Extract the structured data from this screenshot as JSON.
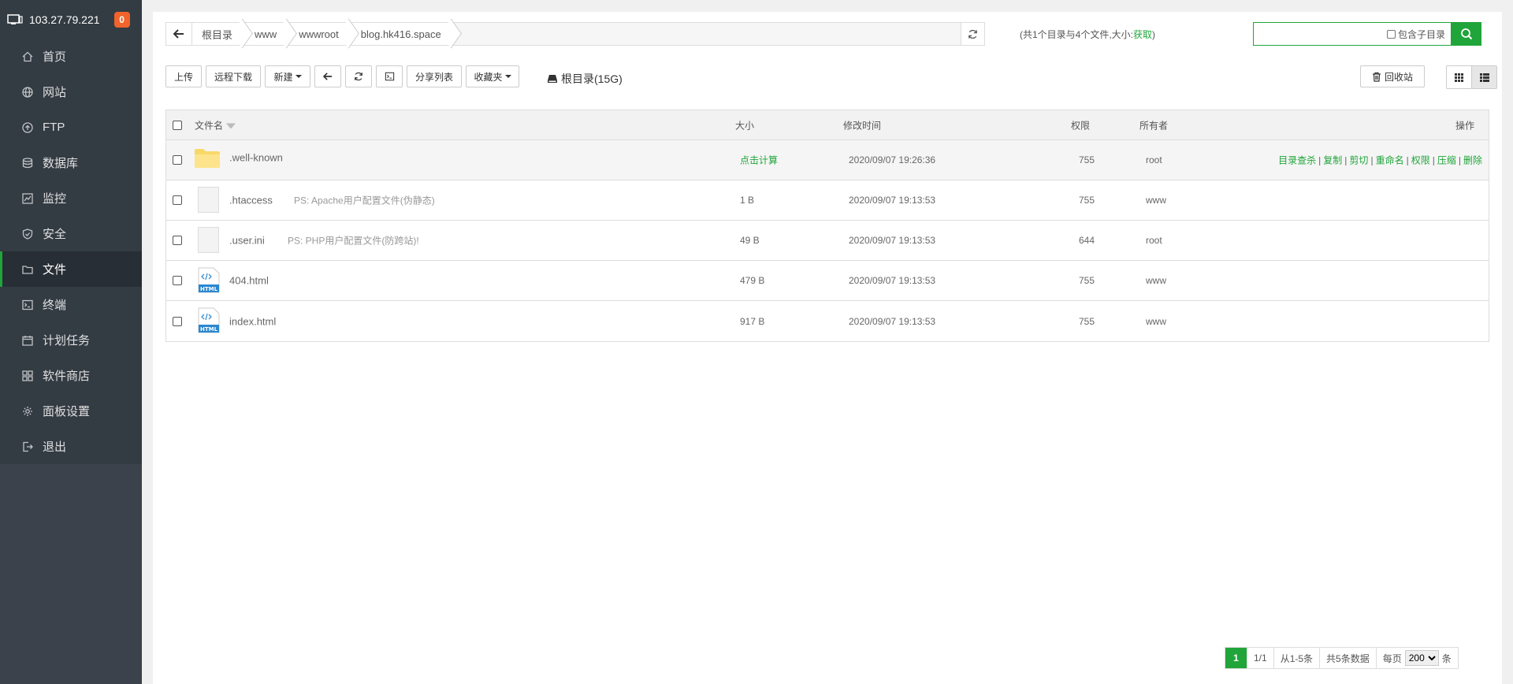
{
  "sidebar": {
    "host": "103.27.79.221",
    "badge": "0",
    "items": [
      {
        "label": "首页",
        "icon": "home-icon"
      },
      {
        "label": "网站",
        "icon": "globe-icon"
      },
      {
        "label": "FTP",
        "icon": "ftp-icon"
      },
      {
        "label": "数据库",
        "icon": "database-icon"
      },
      {
        "label": "监控",
        "icon": "monitor-icon"
      },
      {
        "label": "安全",
        "icon": "shield-icon"
      },
      {
        "label": "文件",
        "icon": "folder-icon"
      },
      {
        "label": "终端",
        "icon": "terminal-icon"
      },
      {
        "label": "计划任务",
        "icon": "calendar-icon"
      },
      {
        "label": "软件商店",
        "icon": "apps-icon"
      },
      {
        "label": "面板设置",
        "icon": "gear-icon"
      },
      {
        "label": "退出",
        "icon": "logout-icon"
      }
    ],
    "active_index": 6
  },
  "path": {
    "crumbs": [
      "根目录",
      "www",
      "wwwroot",
      "blog.hk416.space"
    ],
    "info_prefix": "(共1个目录与4个文件,大小:",
    "info_link": "获取",
    "info_suffix": ")"
  },
  "search": {
    "placeholder": "",
    "subdir_label": "包含子目录"
  },
  "toolbar": {
    "upload": "上传",
    "remote_download": "远程下载",
    "new": "新建",
    "share_list": "分享列表",
    "favorites": "收藏夹",
    "disk": "根目录(15G)",
    "recycle": "回收站"
  },
  "table": {
    "headers": {
      "name": "文件名",
      "size": "大小",
      "mtime": "修改时间",
      "perm": "权限",
      "owner": "所有者",
      "ops": "操作"
    },
    "ops_labels": [
      "目录查杀",
      "复制",
      "剪切",
      "重命名",
      "权限",
      "压缩",
      "删除"
    ],
    "rows": [
      {
        "name": ".well-known",
        "type": "folder",
        "note": "",
        "size": "点击计算",
        "mtime": "2020/09/07 19:26:36",
        "perm": "755",
        "owner": "root"
      },
      {
        "name": ".htaccess",
        "type": "file",
        "note": "PS: Apache用户配置文件(伪静态)",
        "size": "1 B",
        "mtime": "2020/09/07 19:13:53",
        "perm": "755",
        "owner": "www"
      },
      {
        "name": ".user.ini",
        "type": "file",
        "note": "PS: PHP用户配置文件(防跨站)!",
        "size": "49 B",
        "mtime": "2020/09/07 19:13:53",
        "perm": "644",
        "owner": "root"
      },
      {
        "name": "404.html",
        "type": "html",
        "note": "",
        "size": "479 B",
        "mtime": "2020/09/07 19:13:53",
        "perm": "755",
        "owner": "www"
      },
      {
        "name": "index.html",
        "type": "html",
        "note": "",
        "size": "917 B",
        "mtime": "2020/09/07 19:13:53",
        "perm": "755",
        "owner": "www"
      }
    ]
  },
  "pager": {
    "current": "1",
    "pages": "1/1",
    "range": "从1-5条",
    "total": "共5条数据",
    "per_page_label": "每页",
    "per_page_value": "200",
    "unit": "条"
  },
  "colors": {
    "accent": "#20a53a",
    "sidebar_bg": "#3b424b",
    "badge": "#f0632b"
  }
}
